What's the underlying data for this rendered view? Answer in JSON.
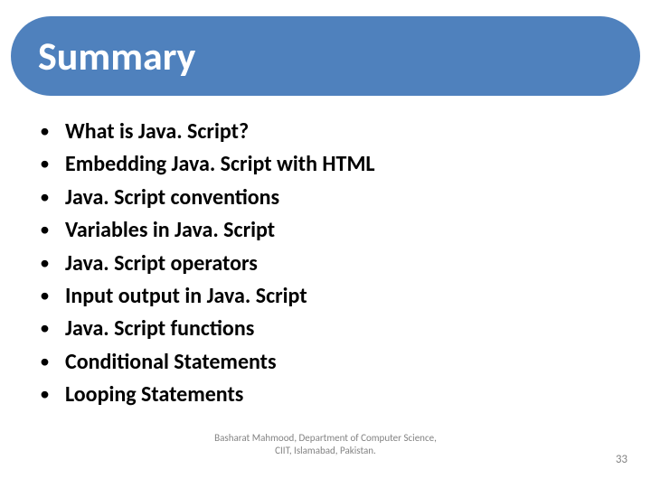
{
  "title": "Summary",
  "bullets": [
    "What is Java. Script?",
    "Embedding Java. Script with HTML",
    "Java. Script conventions",
    "Variables in Java. Script",
    "Java. Script operators",
    "Input output in Java. Script",
    "Java. Script functions",
    "Conditional Statements",
    "Looping Statements"
  ],
  "footer": {
    "attribution": "Basharat Mahmood, Department of Computer Science, CIIT, Islamabad, Pakistan.",
    "page_number": "33"
  }
}
